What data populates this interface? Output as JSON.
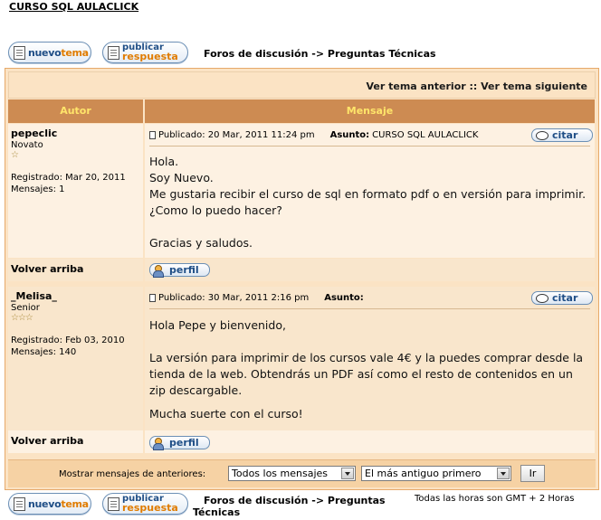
{
  "page": {
    "title": "CURSO SQL AULACLICK"
  },
  "actions": {
    "new_topic_part1": "nuevo",
    "new_topic_part2": "tema",
    "reply_line1": "publicar",
    "reply_line2": "respuesta"
  },
  "breadcrumb": {
    "forum_index": "Foros de discusión",
    "arrow": "->",
    "section": "Preguntas Técnicas"
  },
  "topic_nav": {
    "label": "Ver tema anterior :: Ver tema siguiente"
  },
  "columns": {
    "author": "Autor",
    "message": "Mensaje"
  },
  "posts": [
    {
      "author": "pepeclic",
      "rank": "Novato",
      "stars": "☆",
      "registered": "Registrado: Mar 20, 2011",
      "messages": "Mensajes: 1",
      "posted": "Publicado: 20 Mar, 2011 11:24 pm",
      "subject_label": "Asunto:",
      "subject": "CURSO SQL AULACLICK",
      "quote_label": "citar",
      "lines": [
        "Hola.",
        "Soy Nuevo.",
        "Me gustaria recibir el curso de sql en formato pdf o en versión para imprimir.",
        "¿Como lo puedo hacer?",
        "",
        "Gracias y saludos."
      ],
      "back_to_top": "Volver arriba",
      "profile_label": "perfil"
    },
    {
      "author": "_Melisa_",
      "rank": "Senior",
      "stars": "☆☆☆",
      "registered": "Registrado: Feb 03, 2010",
      "messages": "Mensajes: 140",
      "posted": "Publicado: 30 Mar, 2011 2:16 pm",
      "subject_label": "Asunto:",
      "subject": "",
      "quote_label": "citar",
      "lines": [
        "Hola Pepe y bienvenido,",
        "",
        "La versión para imprimir de los cursos vale 4€ y la puedes comprar desde la",
        "tienda de la web. Obtendrás un PDF así como el resto de contenidos en un",
        "zip descargable.",
        "",
        "Mucha suerte con el curso!"
      ],
      "back_to_top": "Volver arriba",
      "profile_label": "perfil"
    }
  ],
  "footer": {
    "show_label": "Mostrar mensajes de anteriores:",
    "filter_value": "Todos los mensajes",
    "order_value": "El más antiguo primero",
    "go_label": "Ir",
    "timezone": "Todas las horas son GMT + 2 Horas"
  }
}
